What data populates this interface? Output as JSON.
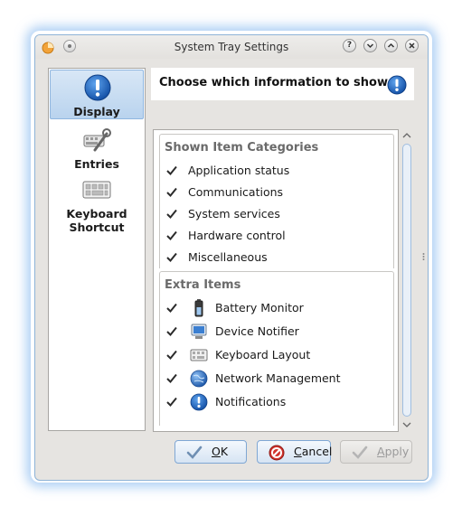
{
  "window": {
    "title": "System Tray Settings"
  },
  "sidebar": {
    "items": [
      {
        "label": "Display",
        "icon": "info-icon",
        "active": true
      },
      {
        "label": "Entries",
        "icon": "tools-icon",
        "active": false
      },
      {
        "label": "Keyboard Shortcut",
        "label_line1": "Keyboard",
        "label_line2": "Shortcut",
        "icon": "keyboard-icon",
        "active": false
      }
    ]
  },
  "header": {
    "text": "Choose which information to show",
    "icon": "info-icon"
  },
  "shown_categories": {
    "title": "Shown Item Categories",
    "items": [
      {
        "label": "Application status",
        "checked": true
      },
      {
        "label": "Communications",
        "checked": true
      },
      {
        "label": "System services",
        "checked": true
      },
      {
        "label": "Hardware control",
        "checked": true
      },
      {
        "label": "Miscellaneous",
        "checked": true
      }
    ]
  },
  "extra_items": {
    "title": "Extra Items",
    "items": [
      {
        "label": "Battery Monitor",
        "checked": true,
        "icon": "battery-icon"
      },
      {
        "label": "Device Notifier",
        "checked": true,
        "icon": "device-notifier-icon"
      },
      {
        "label": "Keyboard Layout",
        "checked": true,
        "icon": "keyboard-layout-icon"
      },
      {
        "label": "Network Management",
        "checked": true,
        "icon": "network-globe-icon"
      },
      {
        "label": "Notifications",
        "checked": true,
        "icon": "notifications-icon"
      }
    ]
  },
  "buttons": {
    "ok": {
      "label": "OK",
      "mnemonic": "O",
      "rest": "K"
    },
    "cancel": {
      "label": "Cancel",
      "mnemonic": "C",
      "rest": "ancel"
    },
    "apply": {
      "label": "Apply",
      "mnemonic": "A",
      "rest": "pply",
      "enabled": false
    }
  },
  "colors": {
    "accent": "#3d7fd0",
    "selection": "#c6dcf2",
    "disabled_text": "#9a9a9a"
  }
}
